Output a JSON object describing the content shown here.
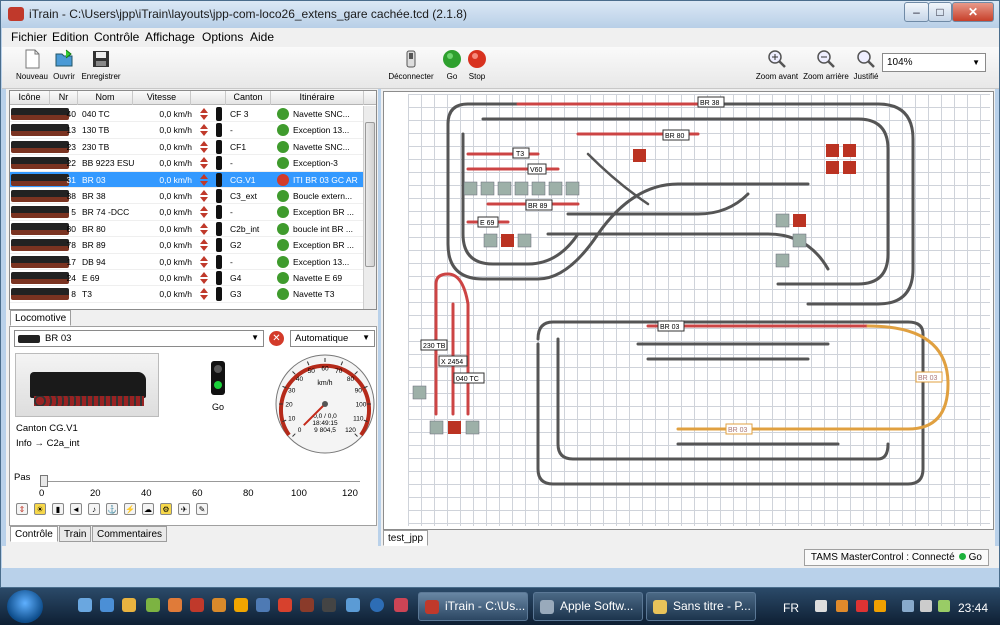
{
  "window": {
    "title": "iTrain - C:\\Users\\jpp\\iTrain\\layouts\\jpp-com-loco26_extens_gare cachée.tcd (2.1.8)"
  },
  "menu": [
    "Fichier",
    "Edition",
    "Contrôle",
    "Affichage",
    "Options",
    "Aide"
  ],
  "toolbar": {
    "nouveau": "Nouveau",
    "ouvrir": "Ouvrir",
    "enregistrer": "Enregistrer",
    "deconnecter": "Déconnecter",
    "go": "Go",
    "stop": "Stop",
    "zoom_avant": "Zoom avant",
    "zoom_arriere": "Zoom arrière",
    "justifie": "Justifié",
    "zoom_value": "104%"
  },
  "table": {
    "headers": [
      "Icône",
      "Nr",
      "Nom",
      "Vitesse",
      "Canton",
      "Itinéraire"
    ],
    "rows": [
      {
        "nr": "40",
        "nom": "040 TC",
        "vitesse": "0,0 km/h",
        "canton": "CF 3",
        "itineraire": "Navette SNC..."
      },
      {
        "nr": "13",
        "nom": "130 TB",
        "vitesse": "0,0 km/h",
        "canton": "-",
        "itineraire": "Exception 13..."
      },
      {
        "nr": "23",
        "nom": "230 TB",
        "vitesse": "0,0 km/h",
        "canton": "CF1",
        "itineraire": "Navette SNC..."
      },
      {
        "nr": "22",
        "nom": "BB 9223 ESU",
        "vitesse": "0,0 km/h",
        "canton": "-",
        "itineraire": "Exception-3"
      },
      {
        "nr": "31",
        "nom": "BR 03",
        "vitesse": "0,0 km/h",
        "canton": "CG.V1",
        "itineraire": "ITI BR 03 GC AR"
      },
      {
        "nr": "38",
        "nom": "BR 38",
        "vitesse": "0,0 km/h",
        "canton": "C3_ext",
        "itineraire": "Boucle extern..."
      },
      {
        "nr": "5",
        "nom": "BR 74 -DCC",
        "vitesse": "0,0 km/h",
        "canton": "-",
        "itineraire": "Exception BR ..."
      },
      {
        "nr": "80",
        "nom": "BR 80",
        "vitesse": "0,0 km/h",
        "canton": "C2b_int",
        "itineraire": "boucle int BR ..."
      },
      {
        "nr": "78",
        "nom": "BR 89",
        "vitesse": "0,0 km/h",
        "canton": "G2",
        "itineraire": "Exception BR ..."
      },
      {
        "nr": "17",
        "nom": "DB 94",
        "vitesse": "0,0 km/h",
        "canton": "-",
        "itineraire": "Exception 13..."
      },
      {
        "nr": "24",
        "nom": "E 69",
        "vitesse": "0,0 km/h",
        "canton": "G4",
        "itineraire": "Navette E 69"
      },
      {
        "nr": "8",
        "nom": "T3",
        "vitesse": "0,0 km/h",
        "canton": "G3",
        "itineraire": "Navette T3"
      }
    ]
  },
  "left_tabs": {
    "locomotive": "Locomotive",
    "controle": "Contrôle",
    "train": "Train",
    "commentaires": "Commentaires"
  },
  "control": {
    "loco_selected": "BR 03",
    "mode": "Automatique",
    "signal_label": "Go",
    "canton": "Canton   CG.V1",
    "info": "Info      → C2a_int",
    "pas_label": "Pas",
    "ticks": [
      "0",
      "20",
      "40",
      "60",
      "80",
      "100",
      "120"
    ],
    "speedo": {
      "unit": "km/h",
      "ticks": [
        "0",
        "10",
        "20",
        "30",
        "40",
        "50",
        "60",
        "70",
        "80",
        "90",
        "100",
        "110",
        "120"
      ],
      "readout": "0,0 / 0,0",
      "time": "18:49:15",
      "distance": "9 804,5",
      "speed_value": 0
    }
  },
  "layout": {
    "tab": "test_jpp",
    "labels": [
      "BR 38",
      "BR 80",
      "T3",
      "V60",
      "BR 89",
      "E 69",
      "230 TB",
      "X 2454",
      "040 TC",
      "BR 03",
      "BR 03",
      "BR 03"
    ]
  },
  "status": {
    "text": "TAMS MasterControl :  Connecté",
    "go": "Go"
  },
  "taskbar": {
    "tasks": [
      "iTrain - C:\\Us...",
      "Apple Softw...",
      "Sans titre - P..."
    ],
    "lang": "FR",
    "clock": "23:44"
  }
}
